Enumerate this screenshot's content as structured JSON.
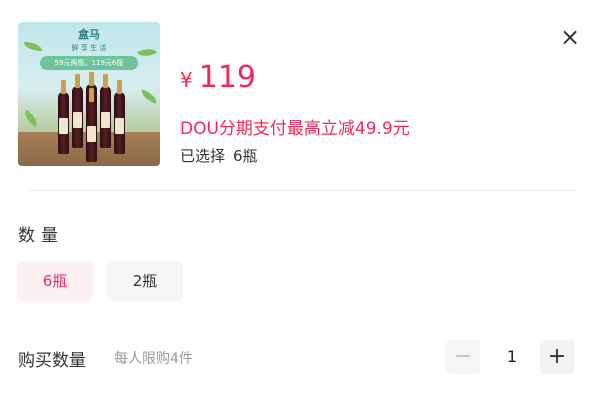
{
  "product": {
    "image_icon": "wine-bottles-product-image",
    "brand_logo": "盒马",
    "brand_sub": "鲜 享 生 活",
    "image_promo": "59元两瓶，119元6瓶",
    "currency": "¥",
    "price": "119",
    "promo": "DOU分期支付最高立减49.9元",
    "selected_label": "已选择",
    "selected_value": "6瓶"
  },
  "close_icon": "×",
  "quantity_section": {
    "label": "数量",
    "options": [
      {
        "label": "6瓶",
        "selected": true
      },
      {
        "label": "2瓶",
        "selected": false
      }
    ]
  },
  "purchase": {
    "label": "购买数量",
    "limit": "每人限购4件",
    "minus": "−",
    "value": "1",
    "plus": "+"
  },
  "colors": {
    "accent": "#f0295a",
    "selected_bg": "#fdf0f2",
    "unselected_bg": "#f5f5f5",
    "muted_text": "#9a9a9a"
  }
}
